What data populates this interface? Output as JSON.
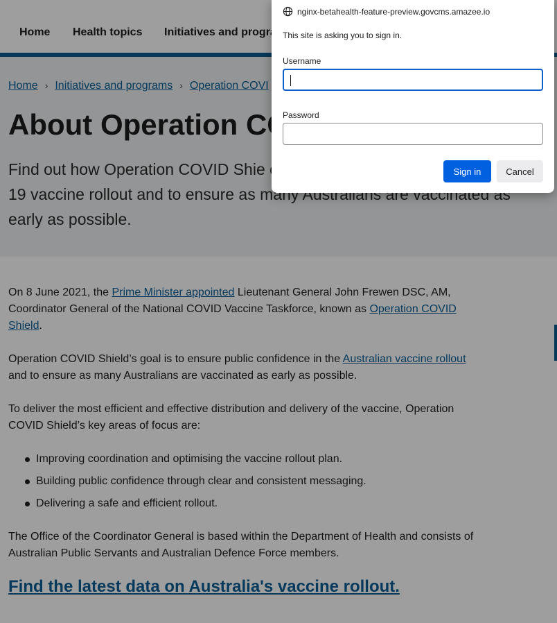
{
  "nav": {
    "items": [
      "Home",
      "Health topics",
      "Initiatives and progra"
    ]
  },
  "breadcrumb": {
    "items": [
      "Home",
      "Initiatives and programs",
      "Operation COVI"
    ]
  },
  "hero": {
    "title": "About Operation CO",
    "lead": "Find out how Operation COVID Shie confidence in the Australian COVID-19 vaccine rollout and to ensure as many Australians are vaccinated as early as possible."
  },
  "content": {
    "p1_a": "On 8 June 2021, the ",
    "p1_link1": "Prime Minister appointed",
    "p1_b": " Lieutenant General John Frewen DSC, AM, Coordinator General of the National COVID Vaccine Taskforce, known as ",
    "p1_link2": "Operation COVID Shield",
    "p1_c": ".",
    "p2_a": "Operation COVID Shield’s goal is to ensure public confidence in the ",
    "p2_link": "Australian vaccine rollout",
    "p2_b": " and to ensure as many Australians are vaccinated as early as possible.",
    "p3": "To deliver the most efficient and effective distribution and delivery of the vaccine, Operation COVID Shield’s key areas of focus are:",
    "bullets": [
      "Improving coordination and optimising the vaccine rollout plan.",
      "Building public confidence through clear and consistent messaging.",
      "Delivering a safe and efficient rollout."
    ],
    "p4": "The Office of the Coordinator General is based within the Department of Health and consists of Australian Public Servants and Australian Defence Force members.",
    "heading_link": "Find the latest data on Australia's vaccine rollout."
  },
  "dialog": {
    "host": "nginx-betahealth-feature-preview.govcms.amazee.io",
    "message": "This site is asking you to sign in.",
    "username_label": "Username",
    "username_value": "",
    "password_label": "Password",
    "password_value": "",
    "signin_label": "Sign in",
    "cancel_label": "Cancel",
    "accent_color": "#0061e0"
  }
}
